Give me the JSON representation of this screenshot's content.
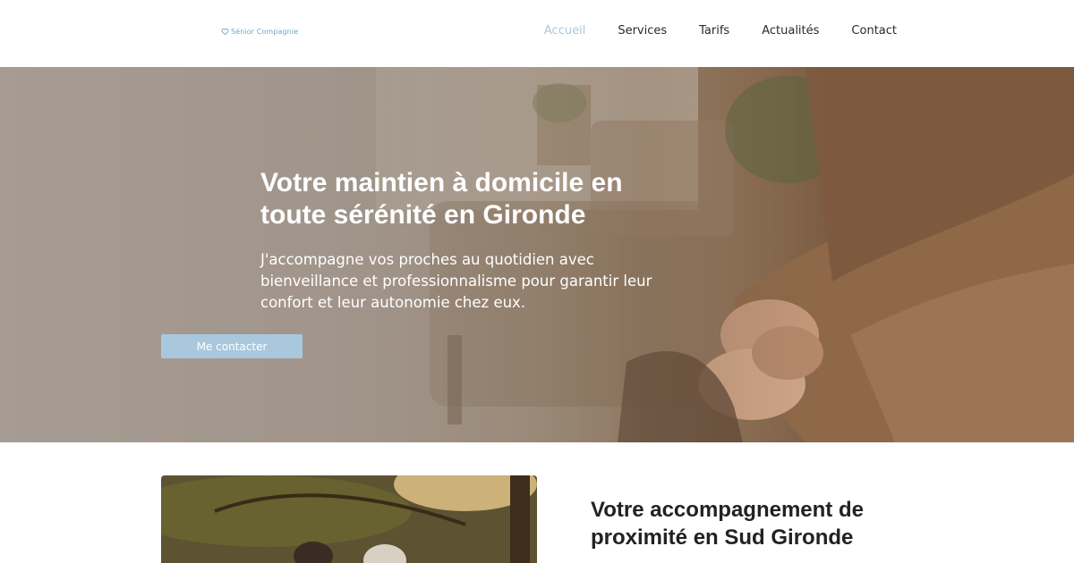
{
  "header": {
    "logo_text": "Sénior Compagnie",
    "logo_icon": "heart-icon",
    "nav": [
      {
        "label": "Accueil",
        "active": true
      },
      {
        "label": "Services",
        "active": false
      },
      {
        "label": "Tarifs",
        "active": false
      },
      {
        "label": "Actualités",
        "active": false
      },
      {
        "label": "Contact",
        "active": false
      }
    ]
  },
  "hero": {
    "title": "Votre maintien à domicile en toute sérénité en Gironde",
    "text": "J'accompagne vos proches au quotidien avec bienveillance et professionnalisme pour garantir leur confort et leur autonomie chez eux.",
    "button_label": "Me contacter"
  },
  "section": {
    "title": "Votre accompagnement de proximité en Sud Gironde"
  },
  "colors": {
    "accent": "#a9c8de",
    "logo": "#6fa6c9",
    "text_dark": "#222222",
    "white": "#ffffff"
  }
}
